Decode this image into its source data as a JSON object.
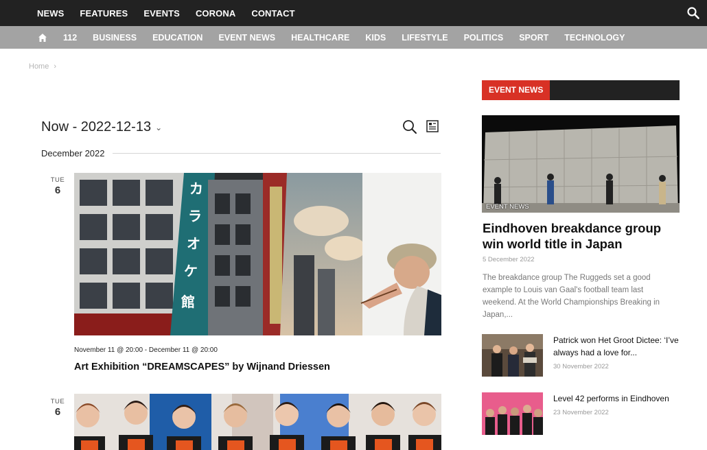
{
  "topnav": {
    "items": [
      "NEWS",
      "FEATURES",
      "EVENTS",
      "CORONA",
      "CONTACT"
    ],
    "search_icon": "search-icon"
  },
  "catnav": {
    "home_icon": "home-icon",
    "items": [
      "112",
      "BUSINESS",
      "EDUCATION",
      "EVENT NEWS",
      "HEALTHCARE",
      "KIDS",
      "LIFESTYLE",
      "POLITICS",
      "SPORT",
      "TECHNOLOGY"
    ]
  },
  "breadcrumb": {
    "home": "Home",
    "sep": "›"
  },
  "events": {
    "range_label": "Now - 2022-12-13",
    "month_label": "December 2022",
    "items": [
      {
        "dow": "TUE",
        "day": "6",
        "time": "November 11 @ 20:00 - December 11 @ 20:00",
        "title": "Art Exhibition “DREAMSCAPES” by Wijnand Driessen"
      },
      {
        "dow": "TUE",
        "day": "6"
      }
    ]
  },
  "sidebar": {
    "section_label": "EVENT NEWS",
    "featured": {
      "category": "EVENT NEWS",
      "title": "Eindhoven breakdance group win world title in Japan",
      "date": "5 December 2022",
      "excerpt": "The breakdance group The Ruggeds set a good example to Louis van Gaal's football team last weekend. At the World Championships Breaking in Japan,..."
    },
    "list": [
      {
        "title": "Patrick won Het Groot Dictee: ‘I’ve always had a love for...",
        "date": "30 November 2022"
      },
      {
        "title": "Level 42 performs in Eindhoven",
        "date": "23 November 2022"
      }
    ]
  },
  "colors": {
    "topbar": "#222222",
    "catbar": "#a3a3a3",
    "accent": "#d83125"
  }
}
